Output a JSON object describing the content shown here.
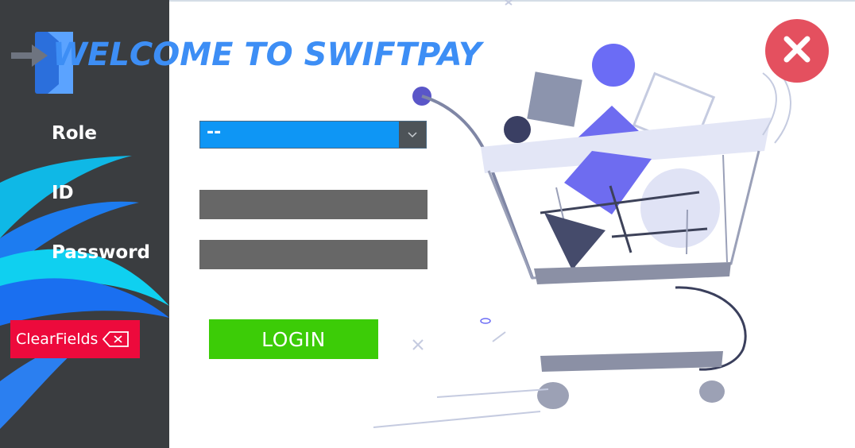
{
  "window": {
    "title": "WELCOME TO SWIFTPAY"
  },
  "form": {
    "role_label": "Role",
    "role_value": "--",
    "id_label": "ID",
    "id_value": "",
    "password_label": "Password",
    "password_value": ""
  },
  "buttons": {
    "clear_label": "ClearFields",
    "login_label": "LOGIN"
  },
  "icons": {
    "logo": "login-door-icon",
    "close": "close-icon",
    "clear": "backspace-icon",
    "dropdown": "chevron-down-icon",
    "illustration": "shopping-cart-illustration"
  },
  "colors": {
    "sidebar": "#3a3d40",
    "title": "#3d8ef5",
    "role_select": "#0e96f5",
    "input": "#676767",
    "clear_button": "#ed0a3c",
    "login_button": "#3ccc07",
    "close_button": "#e4505f"
  }
}
